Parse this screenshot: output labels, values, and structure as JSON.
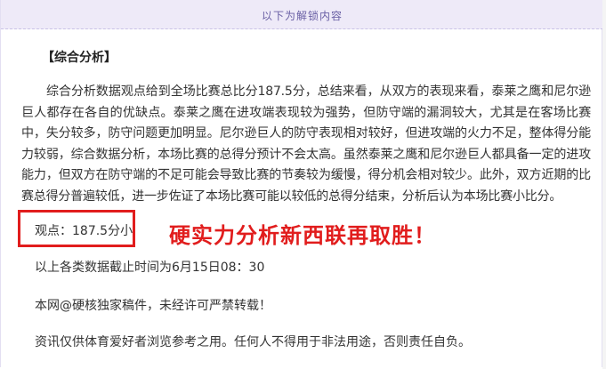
{
  "banner": {
    "text": "以下为解锁内容"
  },
  "article": {
    "heading": "【综合分析】",
    "body": "综合分析数据观点给到全场比赛总比分187.5分，总结来看，从双方的表现来看，泰莱之鹰和尼尔逊巨人都存在各自的优缺点。泰莱之鹰在进攻端表现较为强势，但防守端的漏洞较大，尤其是在客场比赛中，失分较多，防守问题更加明显。尼尔逊巨人的防守表现相对较好，但进攻端的火力不足，整体得分能力较弱，综合数据分析，本场比赛的总得分预计不会太高。虽然泰莱之鹰和尼尔逊巨人都具备一定的进攻能力，但双方在防守端的不足可能会导致比赛的节奏较为缓慢，得分机会相对较少。此外，双方近期的比赛总得分普遍较低，进一步佐证了本场比赛可能以较低的总得分结束，分析后认为本场比赛小比分。",
    "viewpoint": "观点：187.5分小",
    "promo": "硬实力分析新西联再取胜！",
    "cutoff": "以上各类数据截止时间为6月15日08：30",
    "copyright": "本网@硬核独家稿件，未经许可严禁转载！",
    "disclaimer": "资讯仅供体育爱好者浏览参考之用。任何人不得用于非法用途，否则责任自负。"
  },
  "colors": {
    "accent_red": "#e11d1d",
    "banner_bg": "#eeeaf8",
    "banner_text": "#6a60a5"
  }
}
